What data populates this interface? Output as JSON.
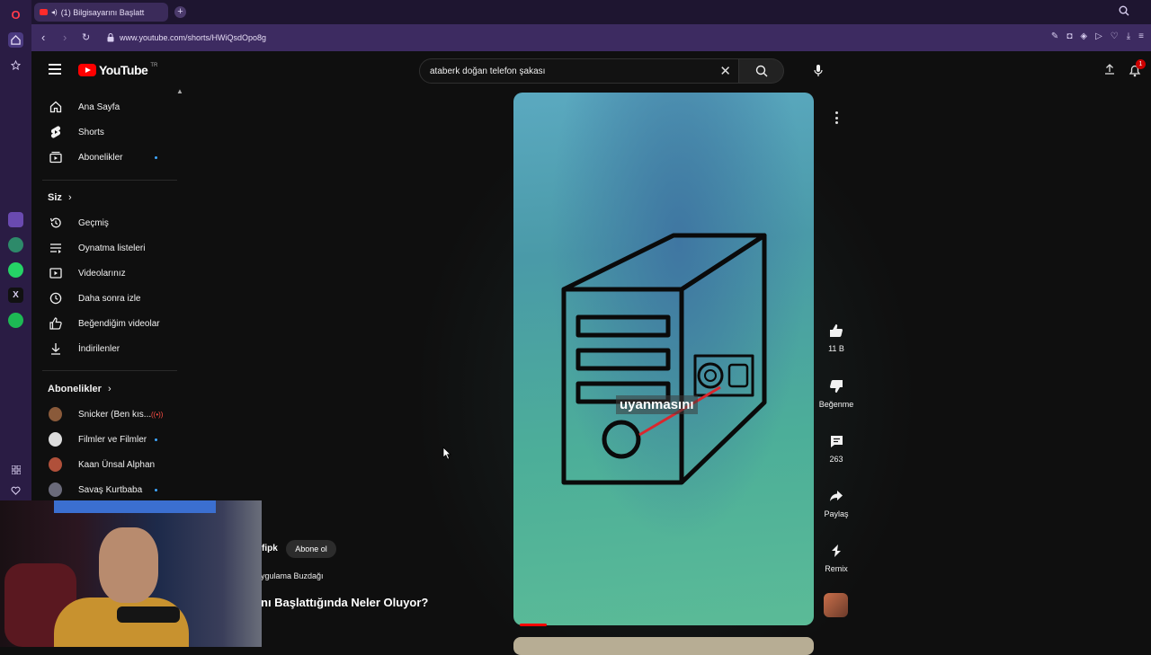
{
  "browser": {
    "tab_title": "(1) Bilgisayarını Başlatt",
    "url": "www.youtube.com/shorts/HWiQsdOpo8g"
  },
  "masthead": {
    "logo_text": "YouTube",
    "country_code": "TR",
    "search_value": "ataberk doğan telefon şakası",
    "notification_count": "1"
  },
  "sidebar": {
    "main_items": [
      {
        "label": "Ana Sayfa",
        "icon": "home-icon"
      },
      {
        "label": "Shorts",
        "icon": "shorts-icon"
      },
      {
        "label": "Abonelikler",
        "icon": "subscriptions-icon"
      }
    ],
    "you_header": "Siz",
    "you_items": [
      {
        "label": "Geçmiş",
        "icon": "history-icon"
      },
      {
        "label": "Oynatma listeleri",
        "icon": "playlists-icon"
      },
      {
        "label": "Videolarınız",
        "icon": "your-videos-icon"
      },
      {
        "label": "Daha sonra izle",
        "icon": "watch-later-icon"
      },
      {
        "label": "Beğendiğim videolar",
        "icon": "liked-videos-icon"
      },
      {
        "label": "İndirilenler",
        "icon": "downloads-icon"
      }
    ],
    "subs_header": "Abonelikler",
    "subs_items": [
      {
        "label": "Snicker (Ben kıs...",
        "color": "#8a5a3a",
        "live": true
      },
      {
        "label": "Filmler ve Filmler",
        "color": "#dddddd",
        "live": false
      },
      {
        "label": "Kaan Ünsal Alphan",
        "color": "#b0503a",
        "live": false
      },
      {
        "label": "Savaş Kurtbaba",
        "color": "#6a6a7a",
        "live": false
      }
    ]
  },
  "short": {
    "caption": "uyanmasını",
    "channel_fragment": "fipk",
    "subscribe_label": "Abone ol",
    "music_fragment": "ygulama Buzdağı",
    "title_fragment": "nı Başlattığında Neler Oluyor?"
  },
  "actions": {
    "likes": "11 B",
    "dislike_label": "Beğenme",
    "comments": "263",
    "share_label": "Paylaş",
    "remix_label": "Remix"
  },
  "colors": {
    "accent_red": "#ff0000",
    "opera_rail": "#2a1c44",
    "address_bar": "#3d2b61"
  }
}
